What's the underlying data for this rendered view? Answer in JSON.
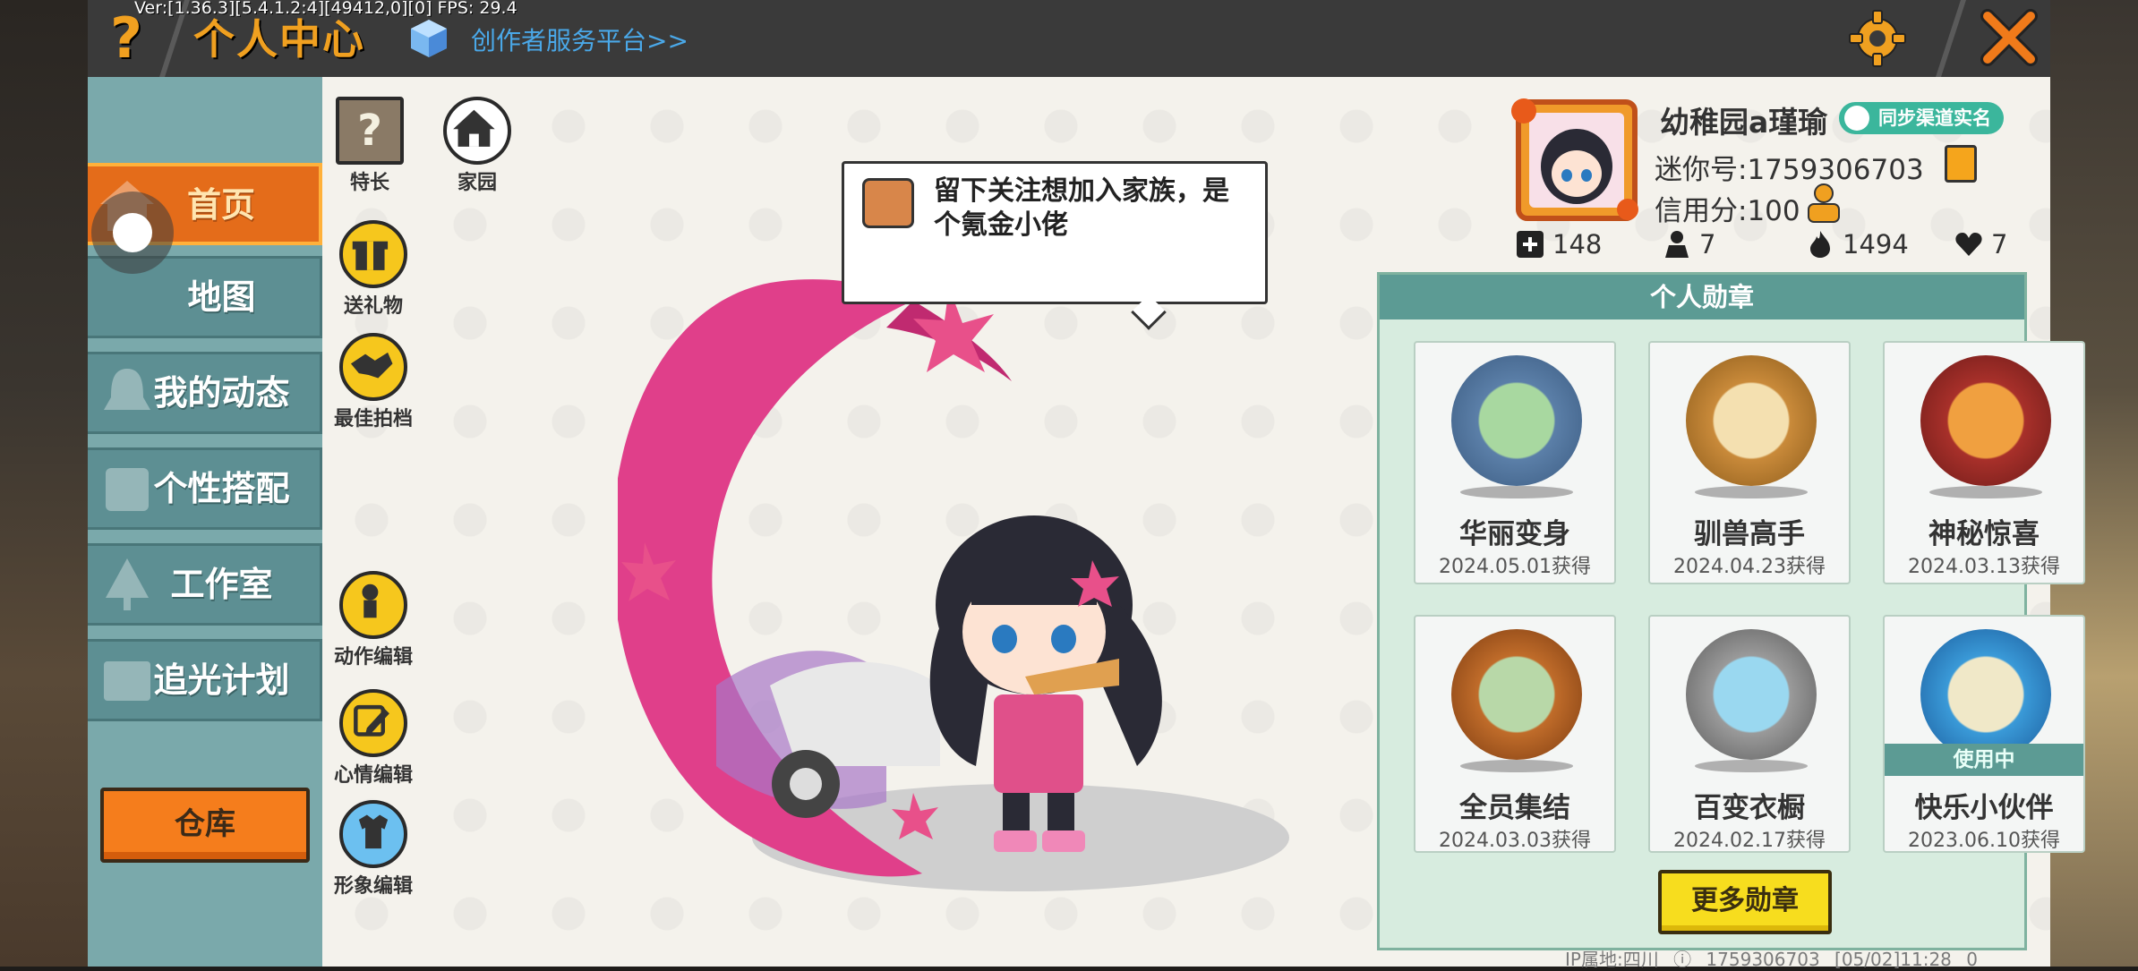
{
  "topbar": {
    "version": "Ver:[1.36.3][5.4.1.2:4][49412,0][0] FPS: 29.4",
    "help_glyph": "?",
    "title": "个人中心",
    "creator_link": "创作者服务平台>>",
    "close_glyph": "✕"
  },
  "sidebar": {
    "items": [
      {
        "label": "首页",
        "active": true
      },
      {
        "label": "地图"
      },
      {
        "label": "我的动态"
      },
      {
        "label": "个性搭配"
      },
      {
        "label": "工作室"
      },
      {
        "label": "追光计划"
      }
    ],
    "storage_label": "仓库"
  },
  "side_buttons": {
    "talent": "特长",
    "home": "家园",
    "gift": "送礼物",
    "partner": "最佳拍档",
    "action_edit": "动作编辑",
    "mood_edit": "心情编辑",
    "image_edit": "形象编辑"
  },
  "bubble": {
    "text": "留下关注想加入家族，是个氪金小佬"
  },
  "profile": {
    "username": "幼稚园a瑾瑜",
    "realname_badge": "同步渠道实名",
    "mini_id": "迷你号:1759306703",
    "credit": "信用分:100",
    "stats": {
      "posts": "148",
      "follows": "7",
      "heat": "1494",
      "likes": "7"
    }
  },
  "medals": {
    "title": "个人勋章",
    "items": [
      {
        "name": "华丽变身",
        "date": "2024.05.01获得",
        "color": "#5b7fa8"
      },
      {
        "name": "驯兽高手",
        "date": "2024.04.23获得",
        "color": "#c98a3a"
      },
      {
        "name": "神秘惊喜",
        "date": "2024.03.13获得",
        "color": "#a8302a"
      },
      {
        "name": "全员集结",
        "date": "2024.03.03获得",
        "color": "#c06c2a"
      },
      {
        "name": "百变衣橱",
        "date": "2024.02.17获得",
        "color": "#9a9a9a"
      },
      {
        "name": "快乐小伙伴",
        "date": "2023.06.10获得",
        "color": "#3a9ad8"
      }
    ],
    "in_use_label": "使用中",
    "more_button": "更多勋章"
  },
  "footer": {
    "ip": "IP属地:四川",
    "uid": "1759306703",
    "time": "[05/02]11:28 0"
  },
  "colors": {
    "accent_orange": "#f0a020",
    "teal": "#5c9b94",
    "sidebar_bg": "#7aa9ab"
  }
}
